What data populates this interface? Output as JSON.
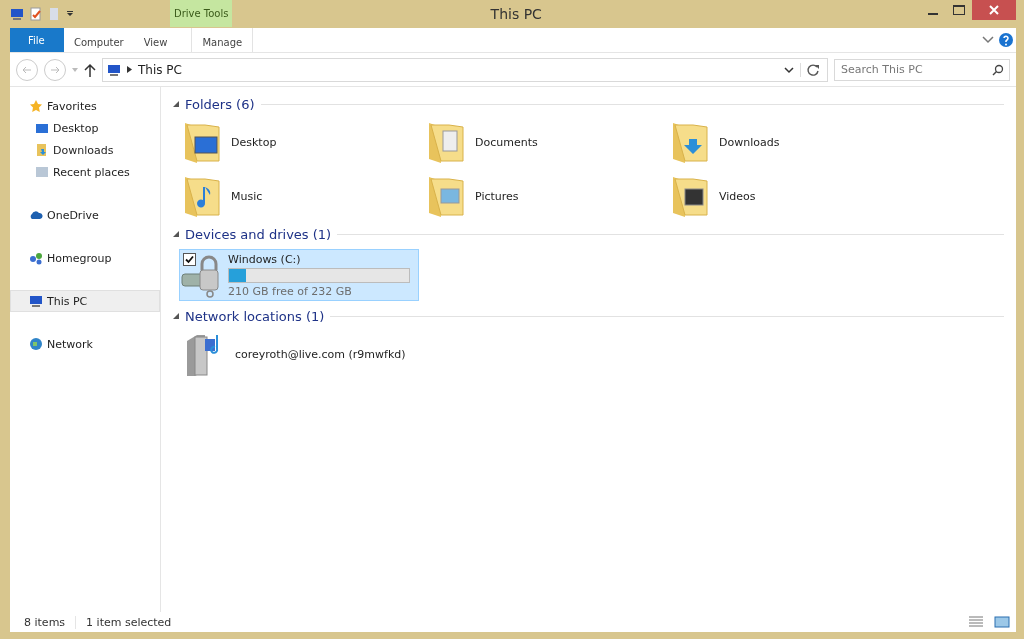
{
  "window": {
    "title": "This PC"
  },
  "context_tab_group": {
    "label": "Drive Tools"
  },
  "ribbon_tabs": [
    {
      "label": "File",
      "kind": "file",
      "selected": false
    },
    {
      "label": "Computer",
      "kind": "tab",
      "selected": false
    },
    {
      "label": "View",
      "kind": "tab",
      "selected": false
    },
    {
      "label": "Manage",
      "kind": "context",
      "selected": false
    }
  ],
  "address_bar": {
    "path": "This PC"
  },
  "search": {
    "placeholder": "Search This PC"
  },
  "sidebar": {
    "items": [
      {
        "label": "Favorites",
        "kind": "group",
        "selected": false
      },
      {
        "label": "Desktop",
        "kind": "link",
        "selected": false
      },
      {
        "label": "Downloads",
        "kind": "link",
        "selected": false
      },
      {
        "label": "Recent places",
        "kind": "link",
        "selected": false
      },
      {
        "label": "OneDrive",
        "kind": "group",
        "selected": false
      },
      {
        "label": "Homegroup",
        "kind": "group",
        "selected": false
      },
      {
        "label": "This PC",
        "kind": "group",
        "selected": true
      },
      {
        "label": "Network",
        "kind": "group",
        "selected": false
      }
    ]
  },
  "sections": [
    {
      "title": "Folders (6)",
      "kind": "folders",
      "items": [
        {
          "label": "Desktop"
        },
        {
          "label": "Documents"
        },
        {
          "label": "Downloads"
        },
        {
          "label": "Music"
        },
        {
          "label": "Pictures"
        },
        {
          "label": "Videos"
        }
      ]
    },
    {
      "title": "Devices and drives (1)",
      "kind": "drives",
      "items": [
        {
          "label": "Windows (C:)",
          "level": 0.095,
          "reading": "210 GB free of 232 GB",
          "selected": true,
          "checked": true
        }
      ]
    },
    {
      "title": "Network locations (1)",
      "kind": "network",
      "items": [
        {
          "label": "coreyroth@live.com (r9mwfkd)"
        }
      ]
    }
  ],
  "status_bar": {
    "item_count": "8 items",
    "selection": "1 item selected"
  }
}
